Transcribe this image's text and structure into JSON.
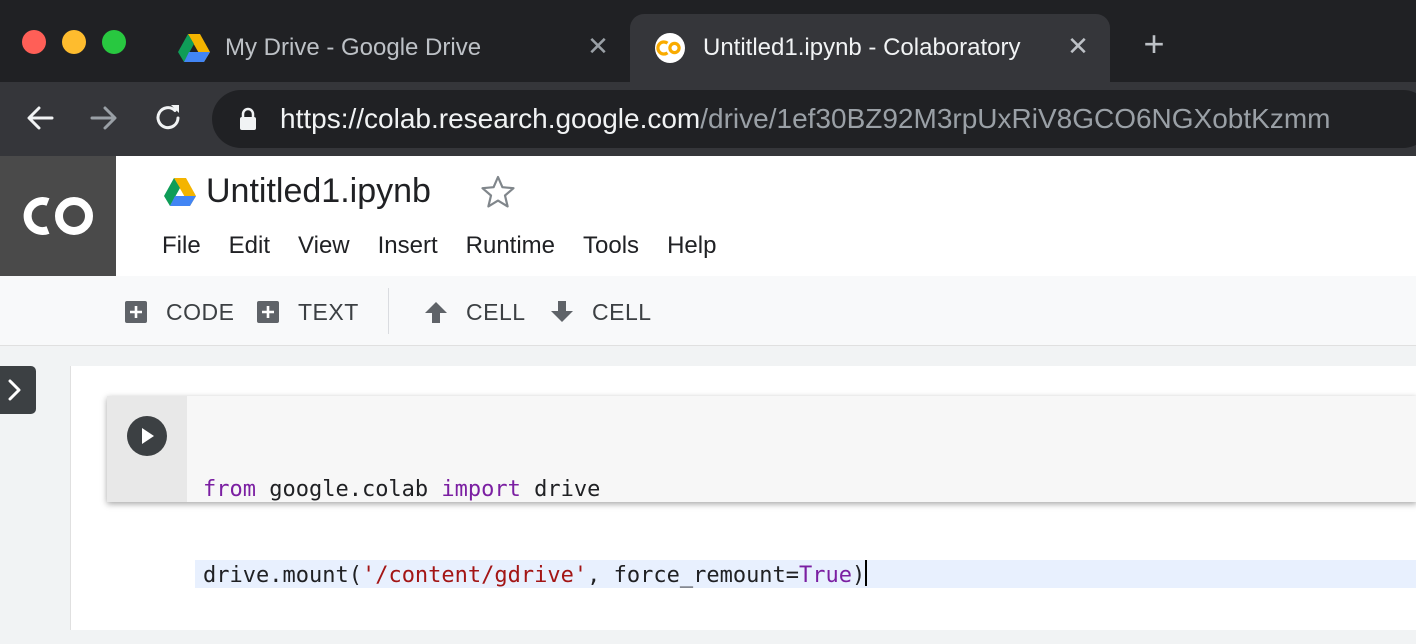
{
  "browser": {
    "tabs": [
      {
        "title": "My Drive - Google Drive",
        "favicon": "google-drive-icon",
        "active": false
      },
      {
        "title": "Untitled1.ipynb - Colaboratory",
        "favicon": "colab-icon",
        "active": true
      }
    ],
    "close_glyph": "✕",
    "new_tab_glyph": "+",
    "url": {
      "scheme": "https://",
      "host": "colab.research.google.com",
      "path": "/drive/1ef30BZ92M3rpUxRiV8GCO6NGXobtKzmm"
    }
  },
  "colab": {
    "logo_text": "CO",
    "notebook_title": "Untitled1.ipynb",
    "menu": [
      "File",
      "Edit",
      "View",
      "Insert",
      "Runtime",
      "Tools",
      "Help"
    ],
    "toolbar": {
      "add_code": "CODE",
      "add_text": "TEXT",
      "move_up": "CELL",
      "move_down": "CELL"
    },
    "cell": {
      "line1": {
        "kw1": "from",
        "mod": " google.colab ",
        "kw2": "import",
        "name": " drive"
      },
      "line2": {
        "call": "drive.mount(",
        "arg": "'/content/gdrive'",
        "mid": ", force_remount=",
        "bool": "True",
        "end": ")"
      }
    }
  },
  "colors": {
    "chrome_dark": "#202124",
    "chrome_mid": "#35363a",
    "drive_green": "#0f9d58",
    "drive_yellow": "#f4b400",
    "drive_blue": "#4285f4",
    "colab_orange": "#f9ab00",
    "keyword": "#7b1fa2",
    "string": "#a31515"
  }
}
